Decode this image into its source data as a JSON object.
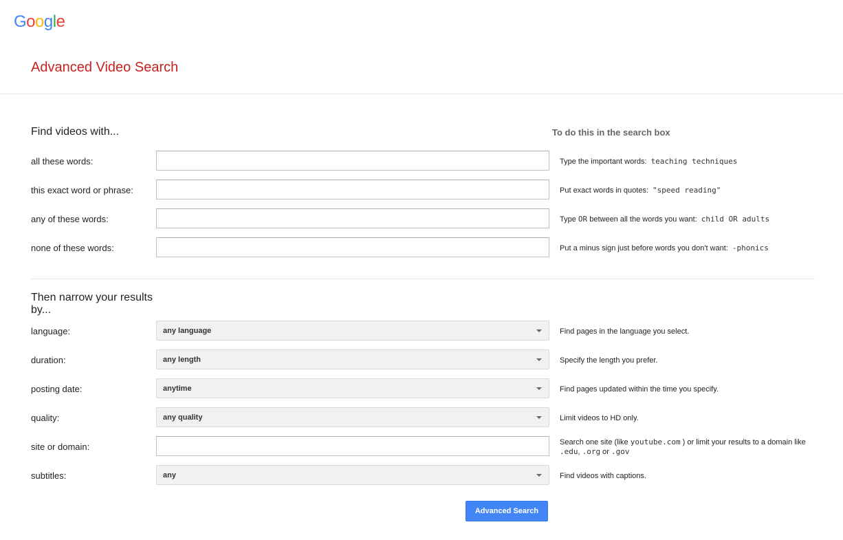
{
  "logo": {
    "letters": [
      "G",
      "o",
      "o",
      "g",
      "l",
      "e"
    ],
    "colors": [
      "#4285f4",
      "#ea4335",
      "#fbbc05",
      "#4285f4",
      "#34a853",
      "#ea4335"
    ]
  },
  "page_title": "Advanced Video Search",
  "find_section": {
    "heading": "Find videos with...",
    "hint_heading": "To do this in the search box",
    "rows": [
      {
        "label": "all these words:",
        "value": "",
        "hint_text": "Type the important words:",
        "hint_example": "teaching techniques"
      },
      {
        "label": "this exact word or phrase:",
        "value": "",
        "hint_text": "Put exact words in quotes:",
        "hint_example": "\"speed reading\""
      },
      {
        "label": "any of these words:",
        "value": "",
        "hint_pre": "Type ",
        "hint_or": "OR",
        "hint_post": " between all the words you want:",
        "hint_example": "child OR adults"
      },
      {
        "label": "none of these words:",
        "value": "",
        "hint_text": "Put a minus sign just before words you don't want:",
        "hint_example": "-phonics"
      }
    ]
  },
  "narrow_section": {
    "heading_line1": "Then narrow your results",
    "heading_line2": "by...",
    "language": {
      "label": "language:",
      "selected": "any language",
      "hint": "Find pages in the language you select."
    },
    "duration": {
      "label": "duration:",
      "selected": "any length",
      "hint": "Specify the length you prefer."
    },
    "posting_date": {
      "label": "posting date:",
      "selected": "anytime",
      "hint": "Find pages updated within the time you specify."
    },
    "quality": {
      "label": "quality:",
      "selected": "any quality",
      "hint": "Limit videos to HD only."
    },
    "site": {
      "label": "site or domain:",
      "value": "",
      "hint_part1": "Search one site (like ",
      "hint_example1": "youtube.com",
      "hint_part2": " ) or limit your results to a domain like",
      "hint_example2": ".edu",
      "hint_sep1": ", ",
      "hint_example3": ".org",
      "hint_sep2": " or ",
      "hint_example4": ".gov"
    },
    "subtitles": {
      "label": "subtitles:",
      "selected": "any",
      "hint": "Find videos with captions."
    }
  },
  "submit_label": "Advanced Search",
  "colors": {
    "title_red": "#c5221f",
    "button_blue": "#4285f4"
  }
}
